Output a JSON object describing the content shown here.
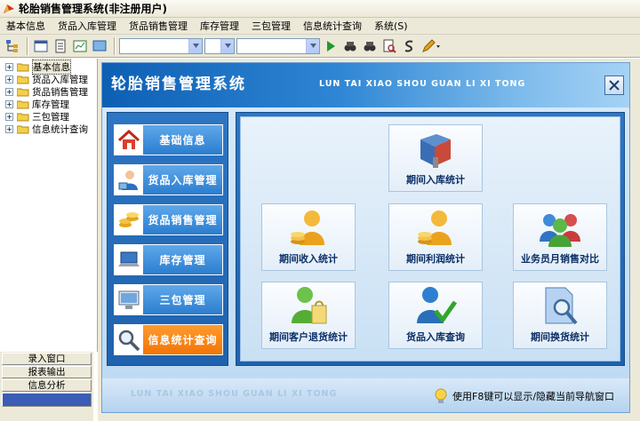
{
  "window": {
    "title": "轮胎销售管理系统(非注册用户)"
  },
  "menu": [
    "基本信息",
    "货品入库管理",
    "货品销售管理",
    "库存管理",
    "三包管理",
    "信息统计查询",
    "系统(S)"
  ],
  "tree": [
    {
      "label": "基本信息",
      "expander": "+",
      "selected": true
    },
    {
      "label": "货品入库管理",
      "expander": "+",
      "selected": false
    },
    {
      "label": "货品销售管理",
      "expander": "+",
      "selected": false
    },
    {
      "label": "库存管理",
      "expander": "+",
      "selected": false
    },
    {
      "label": "三包管理",
      "expander": "+",
      "selected": false
    },
    {
      "label": "信息统计查询",
      "expander": "+",
      "selected": false
    }
  ],
  "leftButtons": [
    "录入窗口",
    "报表输出",
    "信息分析"
  ],
  "panel": {
    "titleCn": "轮胎销售管理系统",
    "titleEn": "LUN TAI XIAO SHOU GUAN LI XI TONG",
    "footerEn": "LUN TAI XIAO SHOU GUAN LI XI TONG",
    "hint": "使用F8键可以显示/隐藏当前导航窗口"
  },
  "nav": [
    {
      "label": "基础信息",
      "icon": "house-icon"
    },
    {
      "label": "货品入库管理",
      "icon": "person-computer-icon"
    },
    {
      "label": "货品销售管理",
      "icon": "coins-icon"
    },
    {
      "label": "库存管理",
      "icon": "laptop-icon"
    },
    {
      "label": "三包管理",
      "icon": "monitor-icon"
    },
    {
      "label": "信息统计查询",
      "icon": "magnifier-icon"
    }
  ],
  "cards": [
    {
      "label": "期间入库统计",
      "icon": "book-icon"
    },
    {
      "label": "期间收入统计",
      "icon": "user-coins-icon"
    },
    {
      "label": "期间利润统计",
      "icon": "user-coins-icon"
    },
    {
      "label": "业务员月销售对比",
      "icon": "users-group-icon"
    },
    {
      "label": "期间客户退货统计",
      "icon": "user-bag-icon"
    },
    {
      "label": "货品入库查询",
      "icon": "user-check-icon"
    },
    {
      "label": "期间换货统计",
      "icon": "doc-magnifier-icon"
    }
  ],
  "colors": {
    "accent": "#2a7dcf",
    "orange": "#f37407",
    "titleText": "#0b2f66"
  }
}
